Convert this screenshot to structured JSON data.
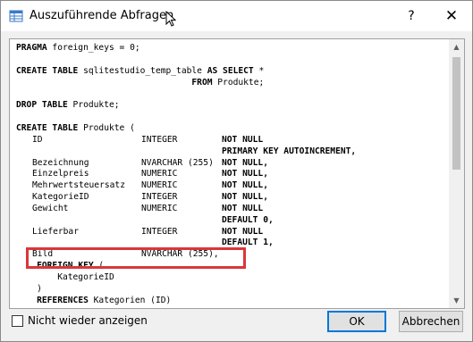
{
  "window": {
    "title": "Auszuführende Abfragen",
    "help_label": "?",
    "close_label": "✕"
  },
  "editor": {
    "lines": [
      {
        "parts": [
          {
            "t": "PRAGMA",
            "b": true
          },
          {
            "t": " foreign_keys = 0;"
          }
        ]
      },
      {
        "parts": []
      },
      {
        "parts": [
          {
            "t": "CREATE TABLE",
            "b": true
          },
          {
            "t": " sqlitestudio_temp_table "
          },
          {
            "t": "AS SELECT",
            "b": true
          },
          {
            "t": " *"
          }
        ]
      },
      {
        "parts": [
          {
            "t": "                                  "
          },
          {
            "t": "FROM",
            "b": true
          },
          {
            "t": " Produkte;"
          }
        ]
      },
      {
        "parts": []
      },
      {
        "parts": [
          {
            "t": "DROP TABLE",
            "b": true
          },
          {
            "t": " Produkte;"
          }
        ]
      },
      {
        "parts": []
      },
      {
        "parts": [
          {
            "t": "CREATE TABLE",
            "b": true
          },
          {
            "t": " Produkte ("
          }
        ]
      },
      {
        "cols": [
          "ID",
          "INTEGER",
          "NOT NULL"
        ],
        "bold3": true
      },
      {
        "cols": [
          "",
          "",
          "PRIMARY KEY AUTOINCREMENT,"
        ],
        "bold3": true
      },
      {
        "cols": [
          "Bezeichnung",
          "NVARCHAR (255)",
          "NOT NULL,"
        ],
        "bold3": true
      },
      {
        "cols": [
          "Einzelpreis",
          "NUMERIC",
          "NOT NULL,"
        ],
        "bold3": true
      },
      {
        "cols": [
          "Mehrwertsteuersatz",
          "NUMERIC",
          "NOT NULL,"
        ],
        "bold3": true
      },
      {
        "cols": [
          "KategorieID",
          "INTEGER",
          "NOT NULL,"
        ],
        "bold3": true
      },
      {
        "cols": [
          "Gewicht",
          "NUMERIC",
          "NOT NULL"
        ],
        "bold3": true
      },
      {
        "cols": [
          "",
          "",
          "DEFAULT 0,"
        ],
        "bold3": true
      },
      {
        "cols": [
          "Lieferbar",
          "INTEGER",
          "NOT NULL"
        ],
        "bold3": true
      },
      {
        "cols": [
          "",
          "",
          "DEFAULT 1,"
        ],
        "bold3": true
      },
      {
        "cols": [
          "Bild",
          "NVARCHAR (255),",
          ""
        ],
        "bold3": false
      },
      {
        "parts": [
          {
            "t": "    "
          },
          {
            "t": "FOREIGN KEY",
            "b": true
          },
          {
            "t": " ("
          }
        ]
      },
      {
        "parts": [
          {
            "t": "        KategorieID"
          }
        ]
      },
      {
        "parts": [
          {
            "t": "    )"
          }
        ]
      },
      {
        "parts": [
          {
            "t": "    "
          },
          {
            "t": "REFERENCES",
            "b": true
          },
          {
            "t": " Kategorien (ID)"
          }
        ]
      }
    ]
  },
  "footer": {
    "checkbox_label": "Nicht wieder anzeigen",
    "checkbox_checked": false,
    "ok_label": "OK",
    "cancel_label": "Abbrechen"
  },
  "colors": {
    "highlight": "#d9373a",
    "ok_border": "#0078d7"
  }
}
